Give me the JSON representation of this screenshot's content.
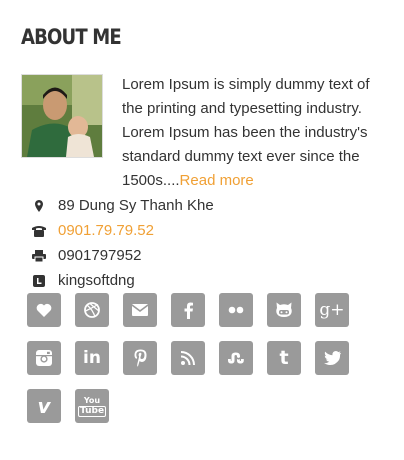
{
  "widget": {
    "title": "ABOUT ME",
    "bio_text": "Lorem Ipsum is simply dummy text of the printing and typesetting industry. Lorem Ipsum has been the industry's standard dummy text ever since the 1500s....",
    "read_more": "Read more"
  },
  "contact": {
    "address": "89 Dung Sy Thanh Khe",
    "phone": "0901.79.79.52",
    "fax": "0901797952",
    "skype": "kingsoftdng"
  },
  "colors": {
    "accent": "#f0a035",
    "button_bg": "#9a9a9a",
    "text": "#333333"
  },
  "social": {
    "icons": [
      "heart-icon",
      "dribbble-icon",
      "email-icon",
      "facebook-icon",
      "flickr-icon",
      "github-icon",
      "google-plus-icon",
      "instagram-icon",
      "linkedin-icon",
      "pinterest-icon",
      "rss-icon",
      "stumbleupon-icon",
      "tumblr-icon",
      "twitter-icon",
      "vimeo-icon",
      "youtube-icon"
    ],
    "gplus_label": "g+",
    "linkedin_label": "in",
    "tumblr_label": "t",
    "vimeo_label": "v",
    "youtube_top": "You",
    "youtube_bottom": "Tube"
  }
}
